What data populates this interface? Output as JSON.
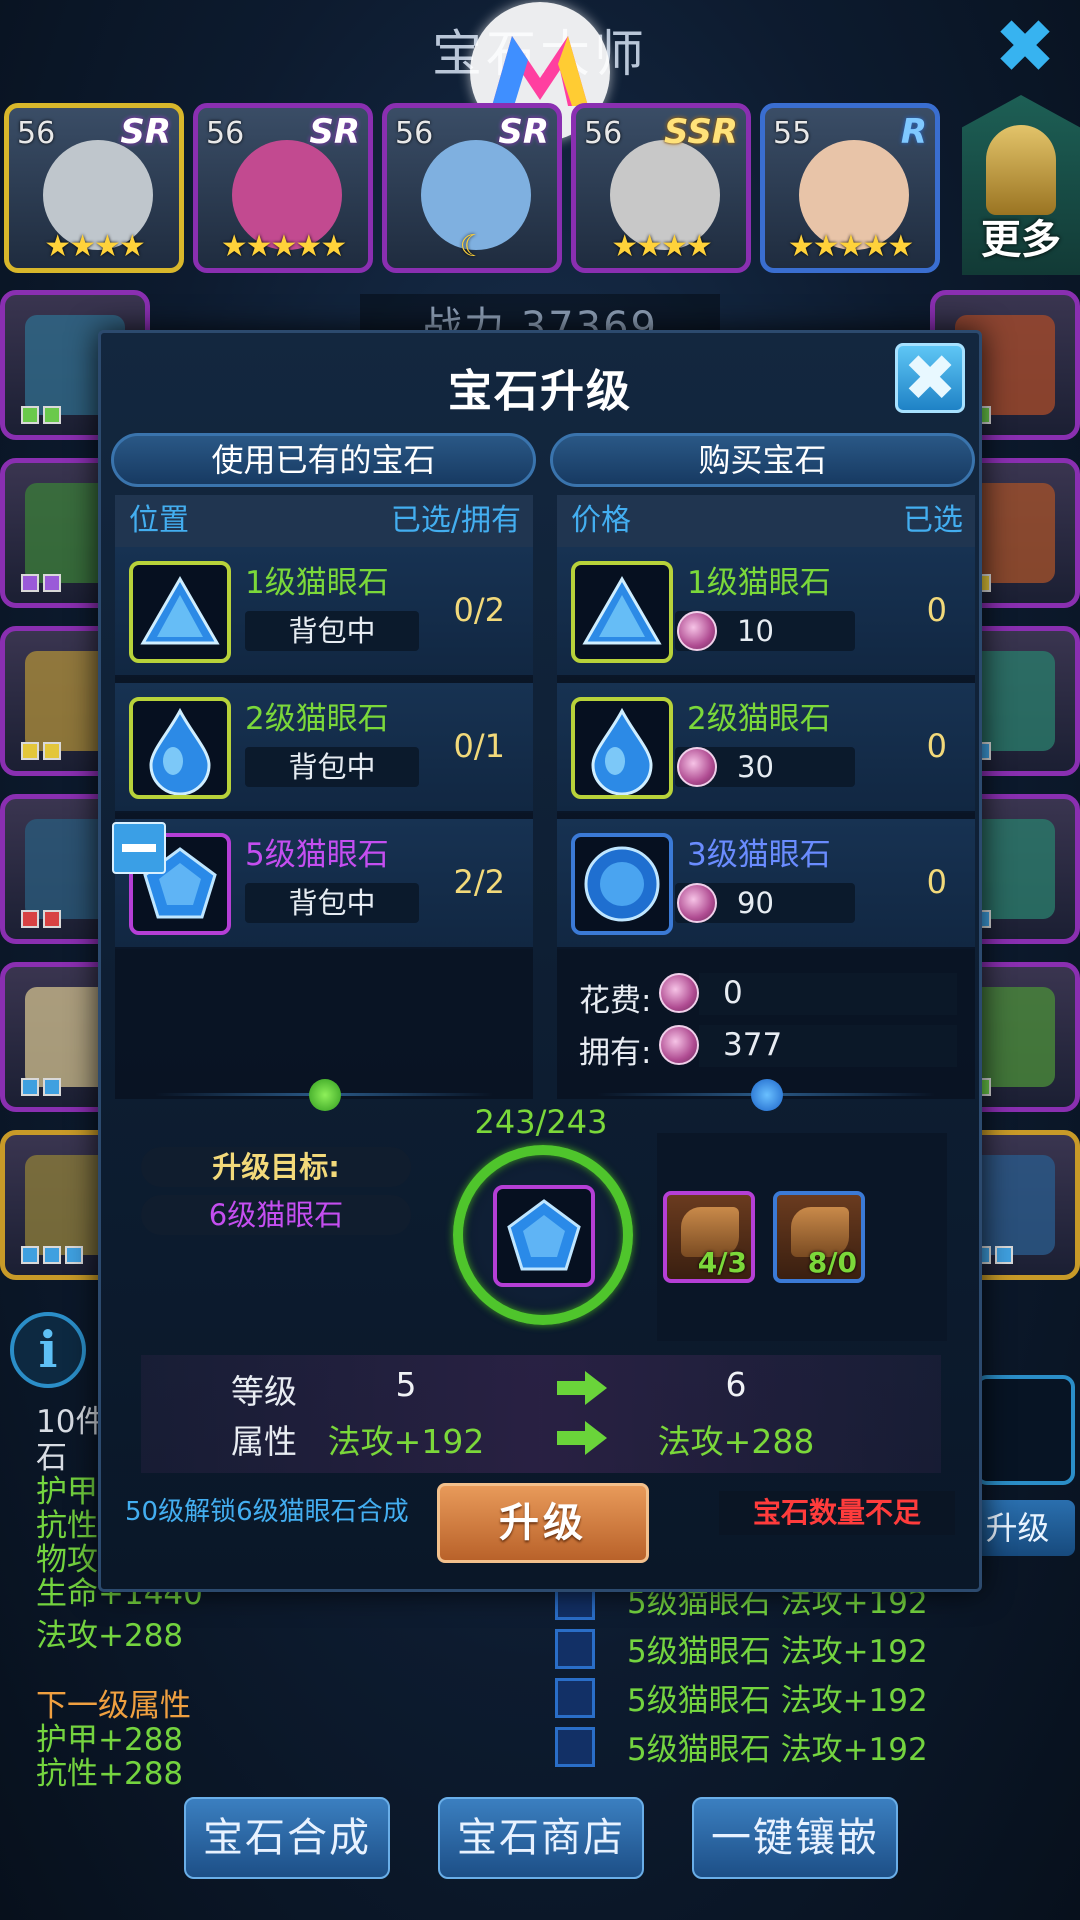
{
  "top": {
    "title": "宝石大师",
    "close_glyph": "✖"
  },
  "heroes": [
    {
      "level": "56",
      "rank": "SR",
      "stars": "★★★★",
      "frame": "gold",
      "face_color": "#bfc6cc"
    },
    {
      "level": "56",
      "rank": "SR",
      "stars": "★★★★★",
      "frame": "purple",
      "face_color": "#c24a90"
    },
    {
      "level": "56",
      "rank": "SR",
      "stars": "☾",
      "frame": "purple",
      "face_color": "#7fb0e0"
    },
    {
      "level": "56",
      "rank": "SSR",
      "stars": "★★★★",
      "frame": "purple",
      "face_color": "#c8c8c8"
    },
    {
      "level": "55",
      "rank": "R",
      "stars": "★★★★★",
      "frame": "blue",
      "face_color": "#e8c4a8"
    }
  ],
  "more_label": "更多",
  "power_text": "战力 37369",
  "modal": {
    "title": "宝石升级",
    "close_glyph": "✖",
    "left_panel": {
      "header": "使用已有的宝石",
      "col_left": "位置",
      "col_right": "已选/拥有",
      "rows": [
        {
          "name": "1级猫眼石",
          "location": "背包中",
          "count": "0/2",
          "color": "green",
          "shape": "triangle"
        },
        {
          "name": "2级猫眼石",
          "location": "背包中",
          "count": "0/1",
          "color": "green",
          "shape": "drop"
        },
        {
          "name": "5级猫眼石",
          "location": "背包中",
          "count": "2/2",
          "color": "purple",
          "shape": "pentagon"
        }
      ]
    },
    "right_panel": {
      "header": "购买宝石",
      "col_left": "价格",
      "col_right": "已选",
      "rows": [
        {
          "name": "1级猫眼石",
          "price": "10",
          "count": "0",
          "color": "green",
          "shape": "triangle"
        },
        {
          "name": "2级猫眼石",
          "price": "30",
          "count": "0",
          "color": "green",
          "shape": "drop"
        },
        {
          "name": "3级猫眼石",
          "price": "90",
          "count": "0",
          "color": "blue",
          "shape": "circle"
        }
      ],
      "cost_label": "花费:",
      "cost_value": "0",
      "owned_label": "拥有:",
      "owned_value": "377"
    },
    "exp_text": "243/243",
    "target_label": "升级目标:",
    "target_value": "6级猫眼石",
    "materials": [
      {
        "count": "4/3",
        "frame": "purple"
      },
      {
        "count": "8/0",
        "frame": "blue"
      }
    ],
    "stats": {
      "level_label": "等级",
      "level_from": "5",
      "level_to": "6",
      "attr_label": "属性",
      "attr_from": "法攻+192",
      "attr_to": "法攻+288"
    },
    "unlock_text": "50级解锁6级猫眼石合成",
    "upgrade_button": "升级",
    "warning": "宝石数量不足"
  },
  "background_info": {
    "line1": "10件",
    "line2": "石",
    "stats": [
      "护甲",
      "抗性",
      "物攻",
      "生命+1440",
      "法攻+288"
    ],
    "next_label": "下一级属性",
    "next_stats": [
      "护甲+288",
      "抗性+288"
    ],
    "gem_list": [
      "5级猫眼石  法攻+192",
      "5级猫眼石  法攻+192",
      "5级猫眼石  法攻+192",
      "5级猫眼石  法攻+192"
    ],
    "upgrade_label": "升级"
  },
  "bottom_buttons": [
    "宝石合成",
    "宝石商店",
    "一键镶嵌"
  ],
  "colors": {
    "accent_blue": "#43aef0",
    "gem_green": "#7bd83a",
    "gem_purple": "#c44ef0",
    "warn_red": "#ff3c3c",
    "gold_text": "#f2d97a"
  }
}
